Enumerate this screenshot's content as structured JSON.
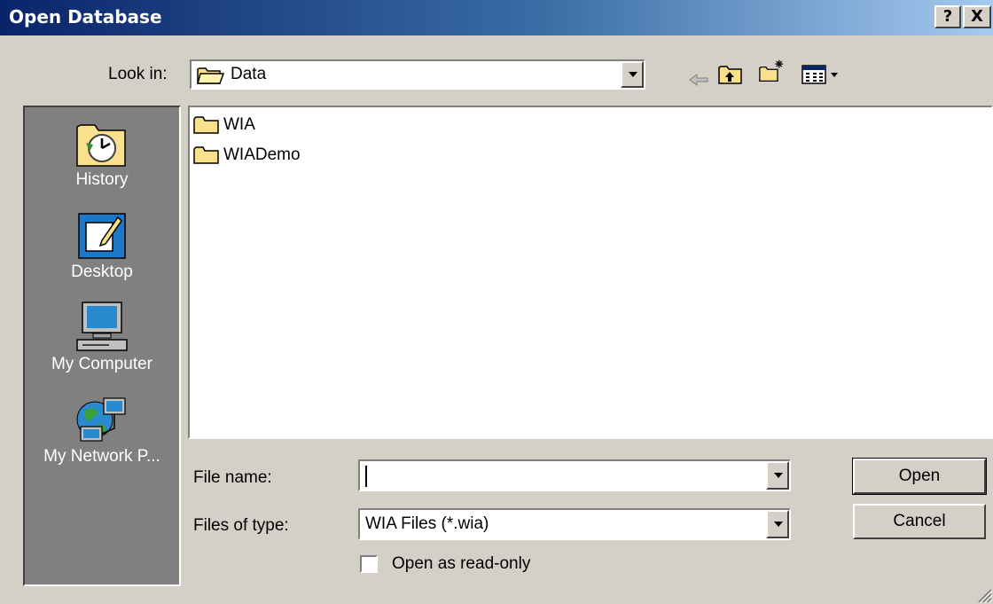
{
  "window": {
    "title": "Open Database",
    "help_glyph": "?",
    "close_glyph": "X"
  },
  "look_in": {
    "label": "Look in:",
    "value": "Data",
    "icon": "open-folder-icon"
  },
  "toolbar": {
    "back_icon": "back-arrow-icon",
    "up_icon": "up-one-level-icon",
    "new_folder_icon": "new-folder-icon",
    "view_menu_icon": "view-menu-icon"
  },
  "places": [
    {
      "label": "History",
      "icon": "history-icon"
    },
    {
      "label": "Desktop",
      "icon": "desktop-icon"
    },
    {
      "label": "My Computer",
      "icon": "my-computer-icon"
    },
    {
      "label": "My Network P...",
      "icon": "my-network-places-icon"
    }
  ],
  "files": [
    {
      "name": "WIA",
      "icon": "folder-icon"
    },
    {
      "name": "WIADemo",
      "icon": "folder-icon"
    }
  ],
  "file_name": {
    "label": "File name:",
    "value": ""
  },
  "file_type": {
    "label": "Files of type:",
    "value": "WIA Files (*.wia)"
  },
  "read_only": {
    "label": "Open as read-only",
    "checked": false
  },
  "buttons": {
    "open": "Open",
    "cancel": "Cancel"
  },
  "colors": {
    "title_bar_start": "#0a246a",
    "title_bar_end": "#a6caf0",
    "dialog_face": "#d4d0c8",
    "places_bar": "#808080",
    "folder": "#f8e08c"
  }
}
